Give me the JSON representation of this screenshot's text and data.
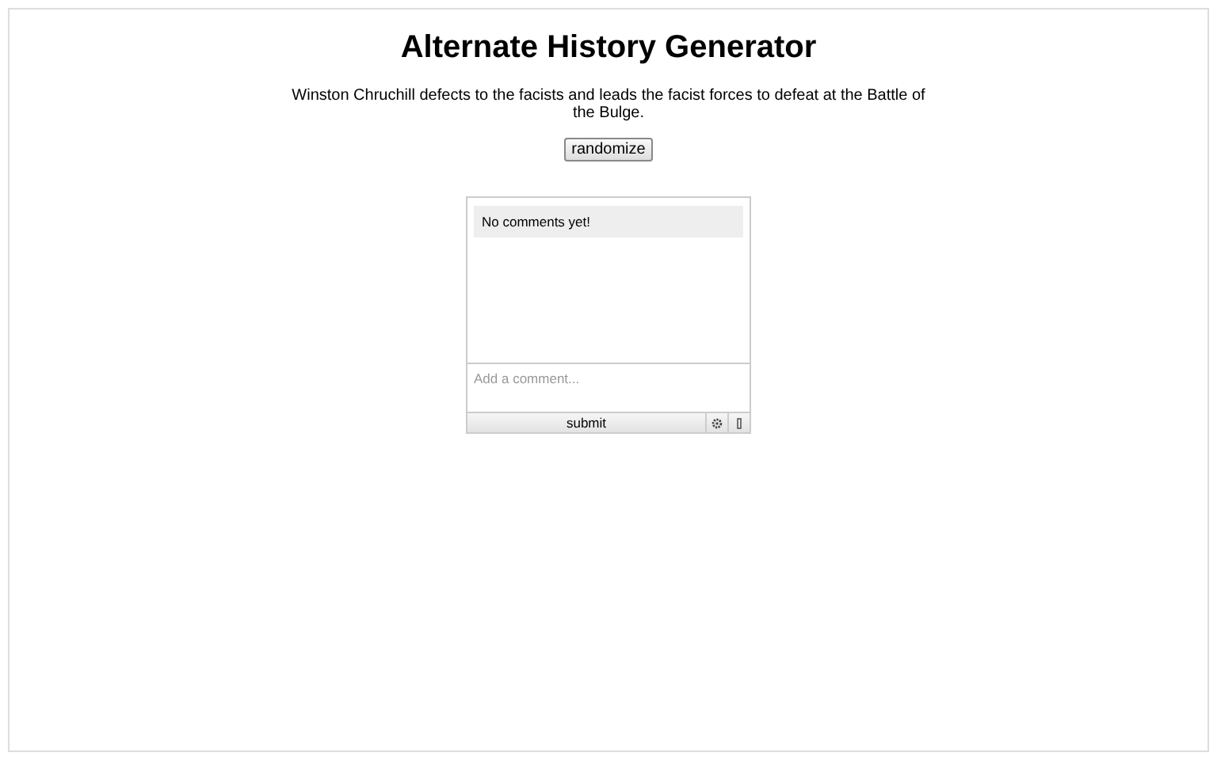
{
  "title": "Alternate History Generator",
  "scenario": "Winston Chruchill defects to the facists and leads the facist forces to defeat at the Battle of the Bulge.",
  "randomize_button": "randomize",
  "comments": {
    "empty_message": "No comments yet!",
    "placeholder": "Add a comment...",
    "submit_button": "submit"
  }
}
